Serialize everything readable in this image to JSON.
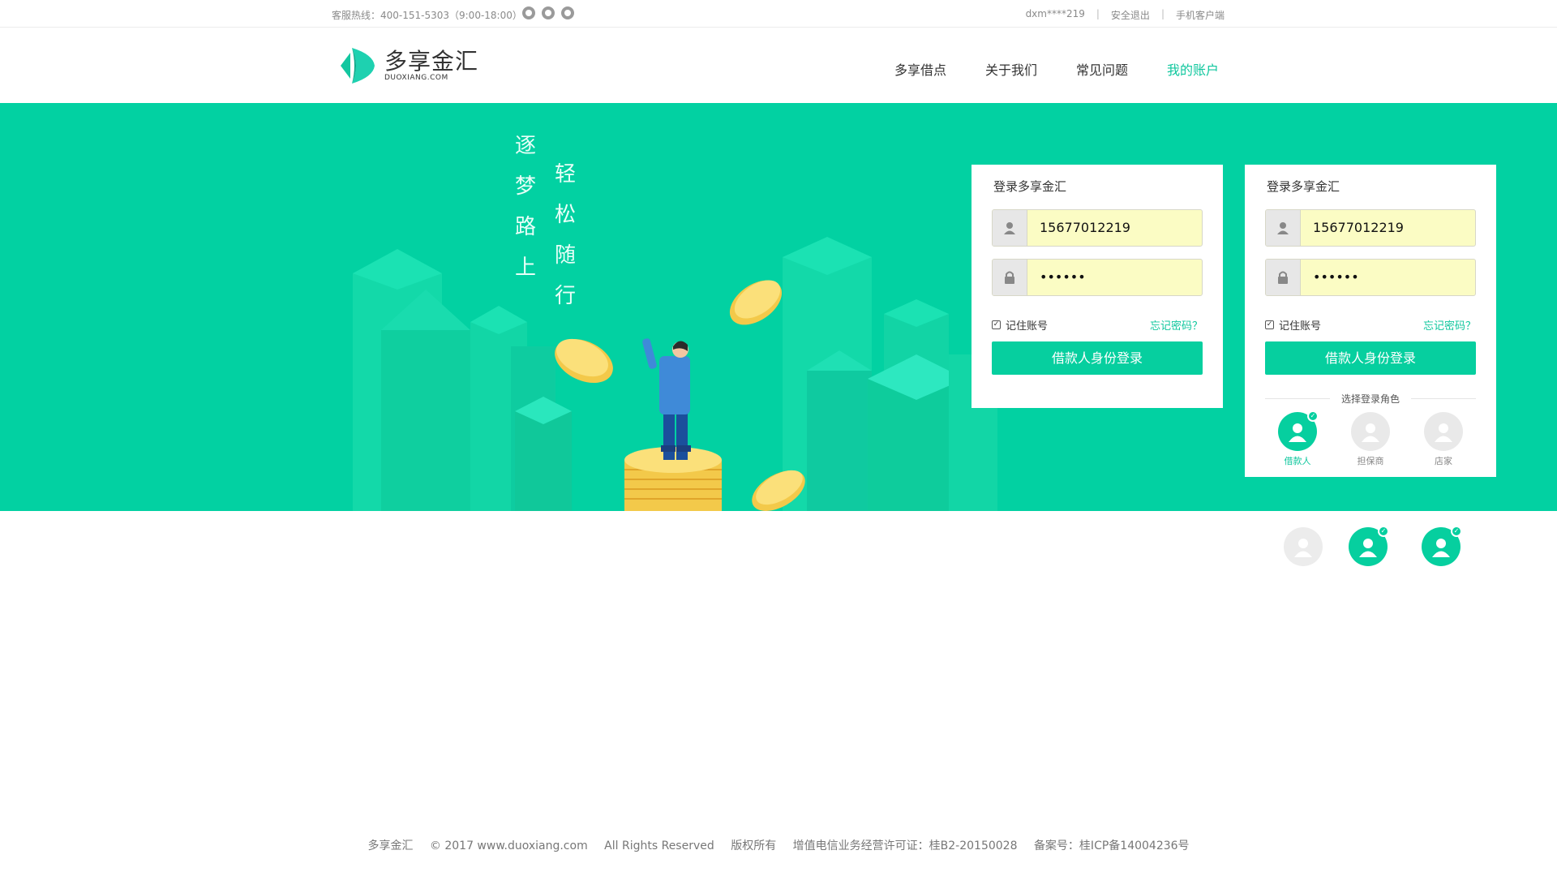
{
  "topbar": {
    "hotline": "客服热线：400-151-5303（9:00-18:00）",
    "user": "dxm****219",
    "logout": "安全退出",
    "mobile": "手机客户端",
    "separator": "|"
  },
  "logo": {
    "name": "多享金汇",
    "domain": "DUOXIANG.COM"
  },
  "nav": [
    {
      "label": "多享借点",
      "active": false
    },
    {
      "label": "关于我们",
      "active": false
    },
    {
      "label": "常见问题",
      "active": false
    },
    {
      "label": "我的账户",
      "active": true
    }
  ],
  "banner": {
    "slogan_left": [
      "逐",
      "梦",
      "路",
      "上"
    ],
    "slogan_right": [
      "轻",
      "松",
      "随",
      "行"
    ],
    "background": "#02d1a2"
  },
  "login_cards": [
    {
      "title": "登录多享金汇",
      "username": "15677012219",
      "password": "••••••",
      "remember": "记住账号",
      "forgot": "忘记密码？",
      "button": "借款人身份登录"
    },
    {
      "title": "登录多享金汇",
      "username": "15677012219",
      "password": "••••••",
      "remember": "记住账号",
      "forgot": "忘记密码？",
      "button": "借款人身份登录",
      "role_title": "选择登录角色",
      "roles": [
        {
          "label": "借款人",
          "selected": true
        },
        {
          "label": "担保商",
          "selected": false
        },
        {
          "label": "店家",
          "selected": false
        }
      ]
    }
  ],
  "footer": {
    "brand": "多享金汇",
    "copyright": "© 2017 www.duoxiang.com",
    "rights": "All Rights Reserved",
    "owned": "版权所有",
    "license": "增值电信业务经营许可证：桂B2-20150028",
    "icp": "备案号：桂ICP备14004236号"
  },
  "colors": {
    "accent": "#06cf9f",
    "field_bg": "#fbfcc4"
  }
}
